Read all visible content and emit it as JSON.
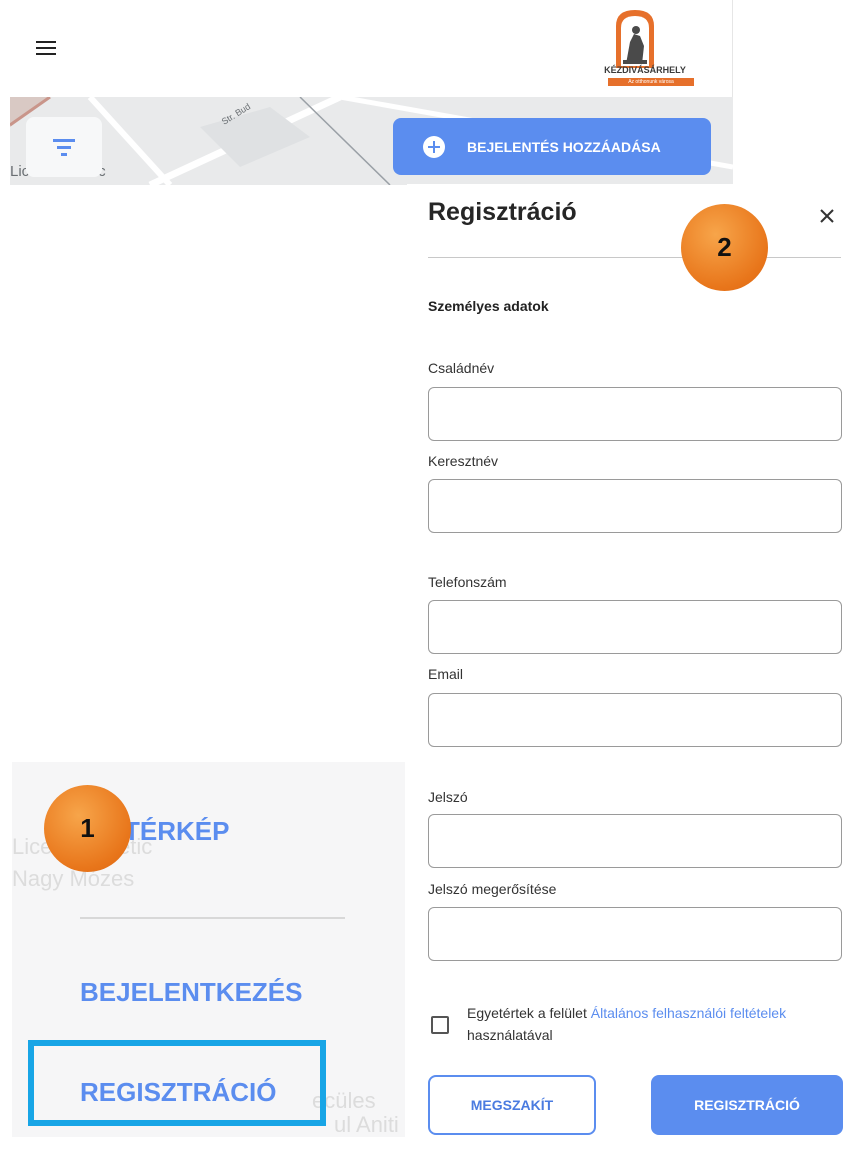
{
  "header": {
    "logo_text": "KÉZDIVÁSÁRHELY",
    "logo_subtext": "Az otthonunk városa"
  },
  "map": {
    "labels": [
      "Liceul Teoretic",
      "Str. Bud"
    ],
    "add_report_label": "BEJELENTÉS HOZZÁADÁSA"
  },
  "side_menu": {
    "items": [
      "TÉRKÉP",
      "BEJELENTKEZÉS",
      "REGISZTRÁCIÓ"
    ],
    "background_labels": [
      "Liceul Teoretic",
      "Nagy Mózes",
      "ecüles",
      "ul Aniti"
    ]
  },
  "annotations": {
    "badge_1": "1",
    "badge_2": "2",
    "badge_color": "#e8751a",
    "highlight_color": "#18a5e6"
  },
  "registration": {
    "title": "Regisztráció",
    "section_title": "Személyes adatok",
    "fields": {
      "last_name": "Családnév",
      "first_name": "Keresztnév",
      "phone": "Telefonszám",
      "email": "Email",
      "password": "Jelszó",
      "password_confirm": "Jelszó megerősítése"
    },
    "terms_prefix": "Egyetértek a felület ",
    "terms_link": "Általános felhasználói feltételek",
    "terms_suffix": " használatával",
    "cancel_label": "MEGSZAKÍT",
    "submit_label": "REGISZTRÁCIÓ"
  },
  "colors": {
    "accent": "#5b8def"
  }
}
